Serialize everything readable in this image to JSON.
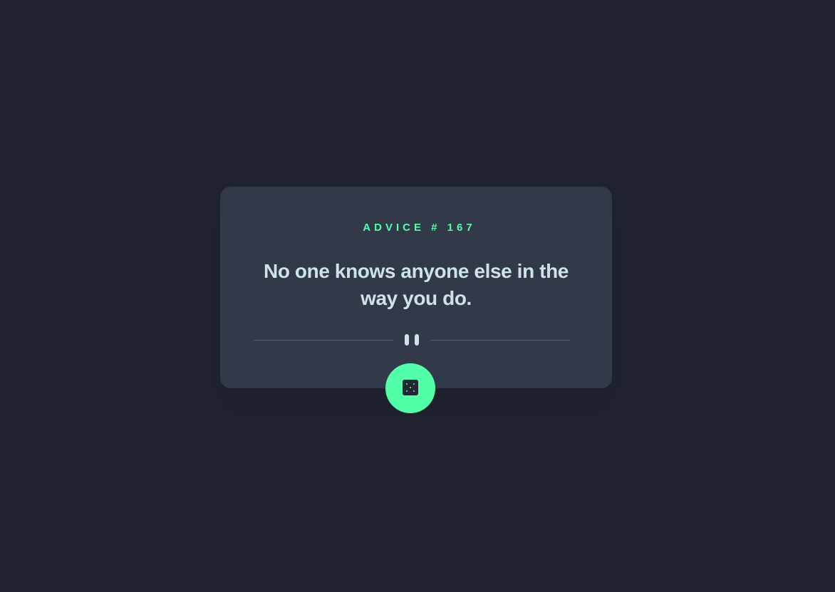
{
  "advice": {
    "label": "ADVICE # 167",
    "text": "No one knows anyone else in the way you do."
  },
  "divider": {
    "icon": "pause-icon"
  },
  "button": {
    "icon": "dice-icon"
  },
  "colors": {
    "background": "#1f2430",
    "card": "#323a49",
    "accent": "#52ffa8",
    "text": "#cee3e9",
    "divider": "#4f5d74"
  }
}
